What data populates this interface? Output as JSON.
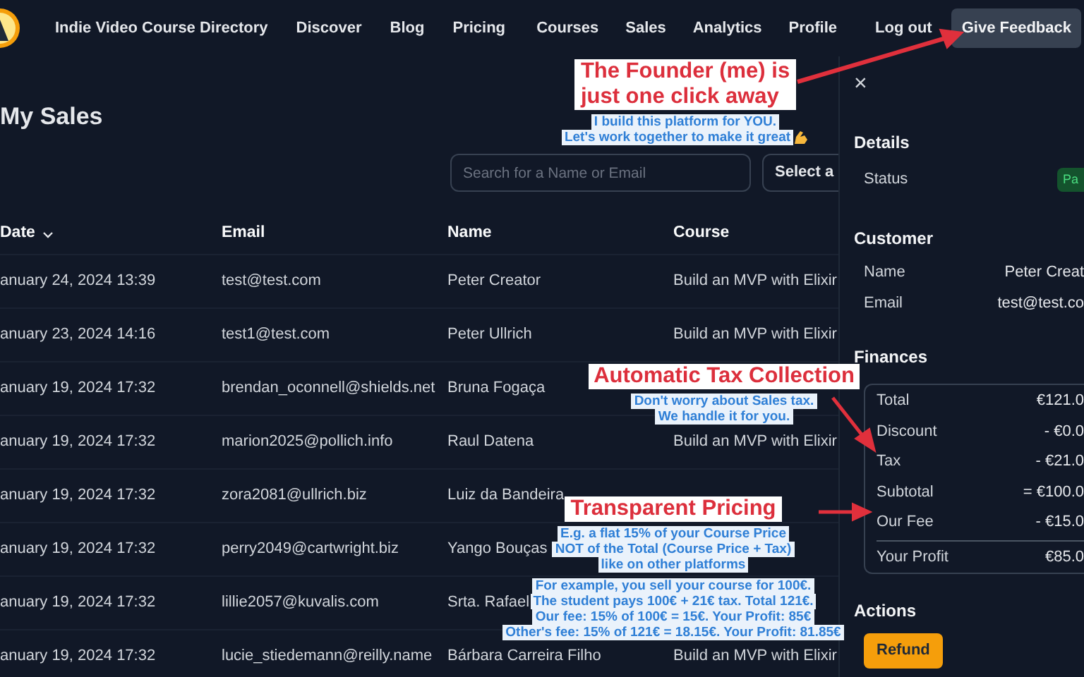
{
  "nav": {
    "brand": "Indie Video Course Directory",
    "left_links": [
      "Discover",
      "Blog",
      "Pricing"
    ],
    "right_links": [
      "Courses",
      "Sales",
      "Analytics",
      "Profile"
    ],
    "logout": "Log out",
    "feedback_button": "Give Feedback"
  },
  "page": {
    "title": "My Sales",
    "search": {
      "placeholder": "Search for a Name or Email"
    },
    "course_select": "Select a"
  },
  "table": {
    "columns": [
      "Date",
      "Email",
      "Name",
      "Course"
    ],
    "rows": [
      {
        "date": "anuary 24, 2024 13:39",
        "email": "test@test.com",
        "name": "Peter Creator",
        "course": "Build an MVP with Elixir"
      },
      {
        "date": "anuary 23, 2024 14:16",
        "email": "test1@test.com",
        "name": "Peter Ullrich",
        "course": "Build an MVP with Elixir"
      },
      {
        "date": "anuary 19, 2024 17:32",
        "email": "brendan_oconnell@shields.net",
        "name": "Bruna Fogaça"
      },
      {
        "date": "anuary 19, 2024 17:32",
        "email": "marion2025@pollich.info",
        "name": "Raul Datena",
        "course": "Build an MVP with Elixir"
      },
      {
        "date": "anuary 19, 2024 17:32",
        "email": "zora2081@ullrich.biz",
        "name": "Luiz da Bandeira"
      },
      {
        "date": "anuary 19, 2024 17:32",
        "email": "perry2049@cartwright.biz",
        "name": "Yango Bouças"
      },
      {
        "date": "anuary 19, 2024 17:32",
        "email": "lillie2057@kuvalis.com",
        "name": "Srta. Rafael"
      },
      {
        "date": "anuary 19, 2024 17:32",
        "email": "lucie_stiedemann@reilly.name",
        "name": "Bárbara Carreira Filho",
        "course": "Build an MVP with Elixir"
      }
    ]
  },
  "drawer": {
    "close": "×",
    "details": {
      "heading": "Details",
      "rows": [
        {
          "label": "Status",
          "badge": "Pa"
        }
      ]
    },
    "customer": {
      "heading": "Customer",
      "rows": [
        {
          "label": "Name",
          "value": "Peter Creat"
        },
        {
          "label": "Email",
          "value": "test@test.co"
        }
      ]
    },
    "finances": {
      "heading": "Finances",
      "rows": [
        {
          "label": "Total",
          "value": "€121.0"
        },
        {
          "label": "Discount",
          "value": "- €0.0"
        },
        {
          "label": "Tax",
          "value": "- €21.0"
        },
        {
          "label": "Subtotal",
          "value": "= €100.0"
        },
        {
          "label": "Our Fee",
          "value": "- €15.0"
        }
      ],
      "profit": {
        "label": "Your Profit",
        "value": "€85.0"
      }
    },
    "actions": {
      "heading": "Actions",
      "refund_button": "Refund"
    }
  },
  "annotations": [
    {
      "title_lines": [
        "The Founder (me) is",
        "just one click away"
      ],
      "lines": [
        "I build this platform for YOU.",
        "Let's work together to make it great"
      ],
      "emoji": true
    },
    {
      "title_lines": [
        "Automatic Tax Collection"
      ],
      "lines": [
        "Don't worry about Sales tax.",
        "We handle it for you."
      ]
    },
    {
      "title_lines": [
        "Transparent Pricing"
      ],
      "lines": [
        "E.g. a flat 15% of your Course Price",
        "NOT of the Total (Course Price + Tax)",
        "like on other platforms",
        "For example, you sell your course for 100€.",
        "The student pays 100€ + 21€ tax. Total 121€.",
        "Our fee: 15% of 100€ = 15€. Your Profit: 85€",
        "Other's fee: 15% of 121€ = 18.15€. Your Profit:  81.85€"
      ]
    }
  ]
}
